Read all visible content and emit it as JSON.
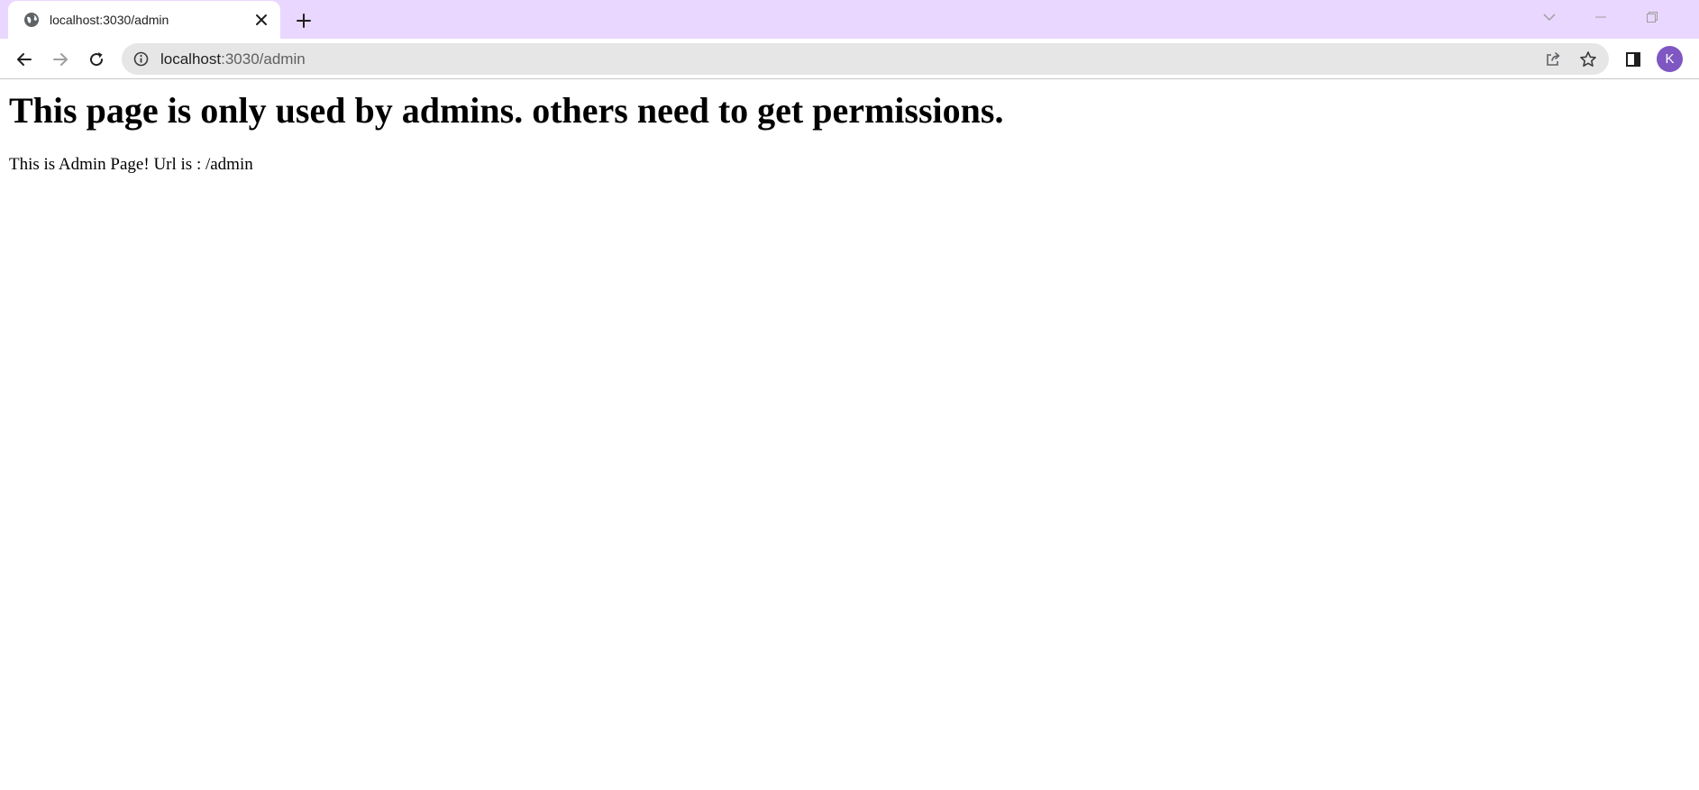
{
  "browser": {
    "tab": {
      "title": "localhost:3030/admin",
      "favicon": "globe-icon"
    },
    "address_bar": {
      "host": "localhost",
      "rest": ":3030/admin"
    },
    "profile_initial": "K",
    "colors": {
      "tab_strip": "#ead7ff",
      "avatar": "#7e57c2"
    }
  },
  "page": {
    "heading": "This page is only used by admins. others need to get permissions.",
    "message": "This is Admin Page! Url is : /admin"
  }
}
